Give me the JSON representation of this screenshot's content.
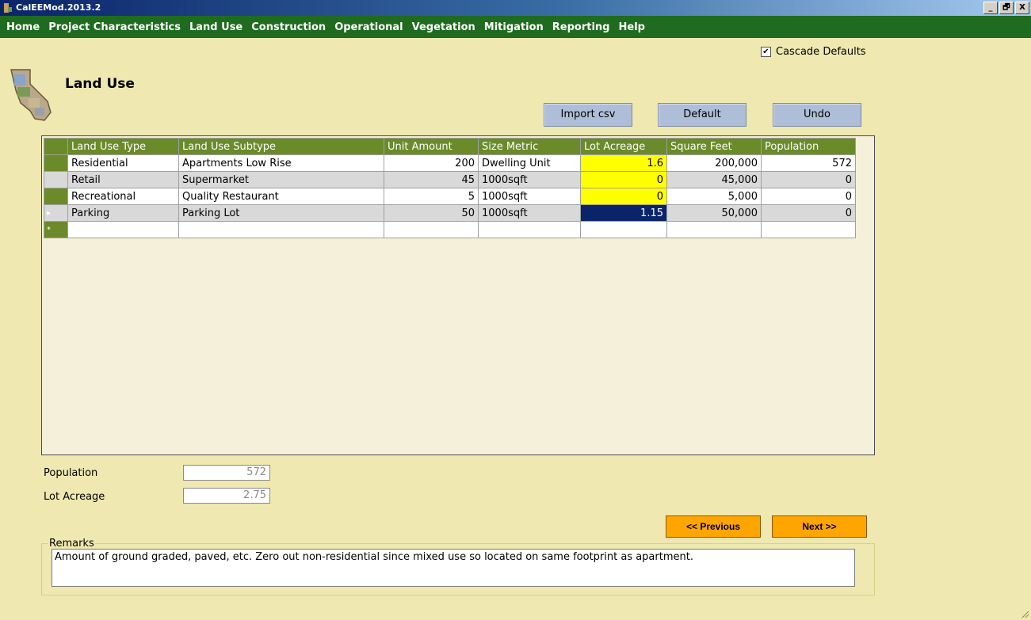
{
  "window": {
    "title": "CalEEMod.2013.2",
    "controls": [
      "_",
      "🗗",
      "X"
    ]
  },
  "menu": [
    "Home",
    "Project Characteristics",
    "Land Use",
    "Construction",
    "Operational",
    "Vegetation",
    "Mitigation",
    "Reporting",
    "Help"
  ],
  "cascade": {
    "label": "Cascade Defaults",
    "checked": true,
    "mark": "✔"
  },
  "page": {
    "title": "Land Use"
  },
  "toolbar": {
    "import_label": "Import csv",
    "default_label": "Default",
    "undo_label": "Undo"
  },
  "grid": {
    "columns": [
      "Land Use Type",
      "Land Use Subtype",
      "Unit Amount",
      "Size Metric",
      "Lot Acreage",
      "Square Feet",
      "Population"
    ],
    "rows": [
      {
        "marker": "",
        "type": "Residential",
        "subtype": "Apartments Low Rise",
        "unit_amount": "200",
        "size_metric": "Dwelling Unit",
        "lot_acreage": "1.6",
        "square_feet": "200,000",
        "population": "572"
      },
      {
        "marker": "",
        "type": "Retail",
        "subtype": "Supermarket",
        "unit_amount": "45",
        "size_metric": "1000sqft",
        "lot_acreage": "0",
        "square_feet": "45,000",
        "population": "0"
      },
      {
        "marker": "",
        "type": "Recreational",
        "subtype": "Quality Restaurant",
        "unit_amount": "5",
        "size_metric": "1000sqft",
        "lot_acreage": "0",
        "square_feet": "5,000",
        "population": "0"
      },
      {
        "marker": "▸",
        "type": "Parking",
        "subtype": "Parking Lot",
        "unit_amount": "50",
        "size_metric": "1000sqft",
        "lot_acreage": "1.15",
        "square_feet": "50,000",
        "population": "0"
      }
    ],
    "new_row_marker": "*"
  },
  "totals": {
    "population_label": "Population",
    "population_value": "572",
    "lot_acreage_label": "Lot Acreage",
    "lot_acreage_value": "2.75"
  },
  "nav": {
    "previous_label": "<< Previous",
    "next_label": "Next >>"
  },
  "remarks": {
    "label": "Remarks",
    "text": "Amount of ground graded, paved, etc.  Zero out non-residential since mixed use so located on same footprint as apartment."
  },
  "colors": {
    "menubar": "#1f6b1f",
    "header": "#6b8a2a",
    "background": "#efe8b0",
    "nav_button": "#ffa500",
    "highlight": "#ffff00",
    "selection": "#0a246a"
  }
}
